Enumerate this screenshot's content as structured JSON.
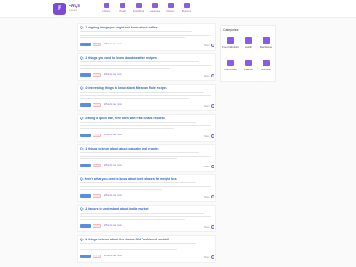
{
  "header": {
    "logo_text": "F",
    "brand": "FAQs",
    "brand_sub": "answers",
    "nav": [
      "Lifestyle",
      "Health",
      "Food/Drink",
      "Automotive",
      "Finance",
      "Business"
    ]
  },
  "cards": [
    {
      "title": "Q: 11 signing things you might not know about coffee",
      "tag1": "Food/Drink",
      "tag2": "Drink",
      "read": "What do we know",
      "share": "Share"
    },
    {
      "title": "Q: 11 things you need to know about weather recipes",
      "tag1": "Food/Drink",
      "tag2": "Drink",
      "read": "What do we know",
      "share": "Share"
    },
    {
      "title": "Q: 10 interesting things to know about Mexican Mole recipes",
      "tag1": "Food/Drink",
      "tag2": "Drink",
      "read": "What do we know",
      "share": "Share"
    },
    {
      "title": "Q: Craving a quick bite, here ones with Fast Snack request",
      "tag1": "Food/Drink",
      "tag2": "Drink",
      "read": "What do we know",
      "share": "Share"
    },
    {
      "title": "Q: 11 things to know about about pancake and veggies",
      "tag1": "Food/Drink",
      "tag2": "Drink",
      "read": "What do we know",
      "share": "Share"
    },
    {
      "title": "Q: Here's what you need to know about best shakes for weight loss",
      "tag1": "Food/Drink",
      "tag2": "Drink",
      "read": "What do we know",
      "share": "Share"
    },
    {
      "title": "Q: 11 factors to understand about bottle market",
      "tag1": "Food/Drink",
      "tag2": "Drink",
      "read": "What do we know",
      "share": "Share"
    },
    {
      "title": "Q: 11 things to know about the classic Old Fashioned cocktail",
      "tag1": "Food/Drink",
      "tag2": "Drink",
      "read": "What do we know",
      "share": "Share"
    }
  ],
  "sidebar": {
    "title": "Categories",
    "categories": [
      "Food & Drinks",
      "Health",
      "Real Estate",
      "Automotive",
      "Finance",
      "Business"
    ]
  }
}
